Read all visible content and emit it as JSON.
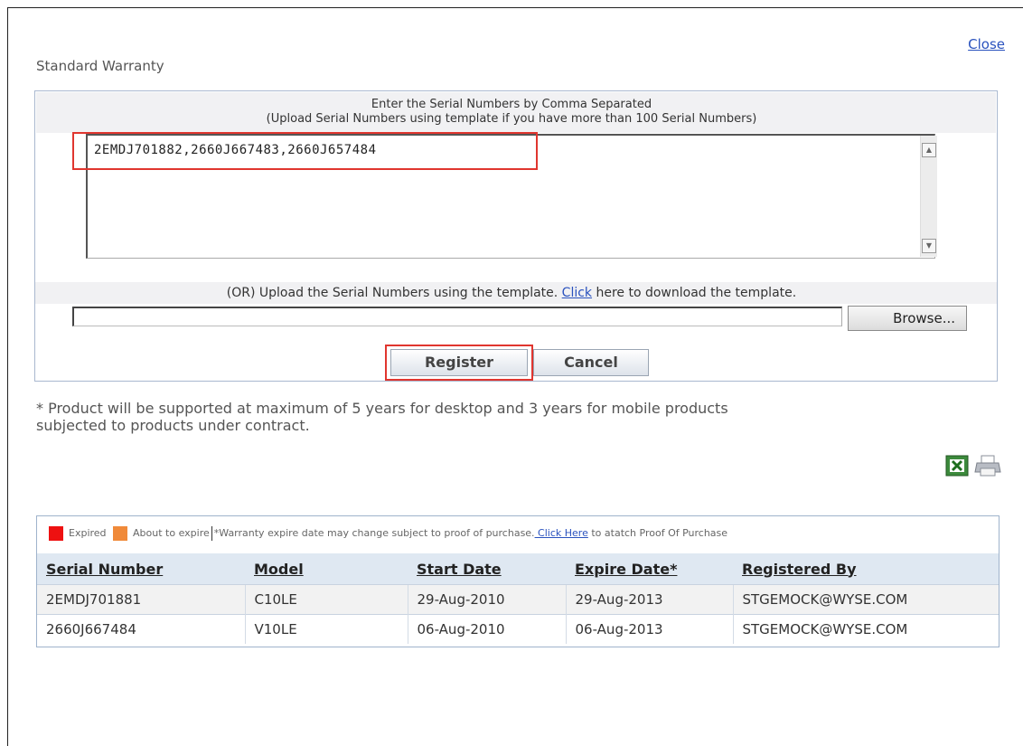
{
  "dialog": {
    "close_label": "Close",
    "title": "Standard Warranty"
  },
  "form": {
    "instruction_line1": "Enter the Serial Numbers by Comma Separated",
    "instruction_line2": "(Upload Serial Numbers using template if you have more than 100 Serial Numbers)",
    "serial_input_value": "2EMDJ701882,2660J667483,2660J657484",
    "upload_text_before": "(OR) Upload the Serial Numbers using the template. ",
    "upload_link": "Click",
    "upload_text_after": " here to download the template.",
    "file_input_value": "",
    "browse_label": "Browse...",
    "register_label": "Register",
    "cancel_label": "Cancel"
  },
  "note": {
    "line1": "* Product will be supported at maximum of 5 years for desktop and 3 years for mobile products",
    "line2": "subjected to products under contract."
  },
  "toolbar": {
    "excel_icon": "excel-icon",
    "print_icon": "print-icon"
  },
  "legend": {
    "expired": "Expired",
    "about_to_expire": "About to expire",
    "disclaimer": "*Warranty expire date may change subject to proof of purchase.",
    "click_here": " Click Here",
    "attach_text": " to atatch Proof Of Purchase",
    "colors": {
      "expired": "#ee1111",
      "about_to_expire": "#f08a3a"
    }
  },
  "table": {
    "headers": [
      "Serial Number",
      "Model",
      "Start Date",
      "Expire Date*",
      "Registered By"
    ],
    "rows": [
      [
        "2EMDJ701881",
        "C10LE",
        "29-Aug-2010",
        "29-Aug-2013",
        "STGEMOCK@WYSE.COM"
      ],
      [
        "2660J667484",
        "V10LE",
        "06-Aug-2010",
        "06-Aug-2013",
        "STGEMOCK@WYSE.COM"
      ]
    ]
  }
}
